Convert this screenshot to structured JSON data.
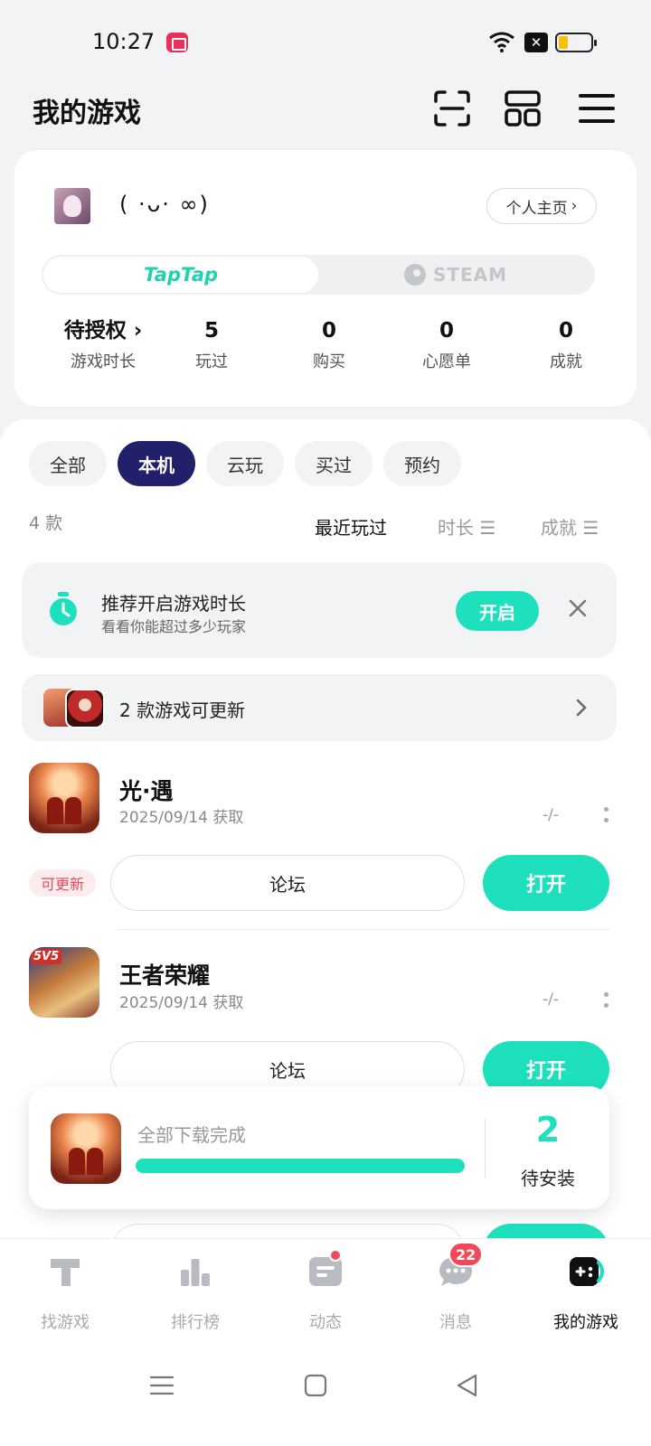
{
  "status_bar": {
    "time": "10:27"
  },
  "header": {
    "title": "我的游戏"
  },
  "profile": {
    "nickname": "( ·ᴗ· ∞)",
    "profile_button": "个人主页",
    "platforms": {
      "taptap": "TapTap",
      "steam": "STEAM"
    },
    "stats": [
      {
        "value": "待授权",
        "label": "游戏时长"
      },
      {
        "value": "5",
        "label": "玩过"
      },
      {
        "value": "0",
        "label": "购买"
      },
      {
        "value": "0",
        "label": "心愿单"
      },
      {
        "value": "0",
        "label": "成就"
      }
    ]
  },
  "filters": [
    "全部",
    "本机",
    "云玩",
    "买过",
    "预约"
  ],
  "active_filter": "本机",
  "list_count": "4 款",
  "sort": {
    "recent": "最近玩过",
    "duration": "时长",
    "achievement": "成就"
  },
  "banner": {
    "title": "推荐开启游戏时长",
    "subtitle": "看看你能超过多少玩家",
    "button": "开启"
  },
  "update_notice": "2 款游戏可更新",
  "games": [
    {
      "name": "光·遇",
      "date": "2025/09/14 获取",
      "playtime": "-/-",
      "tag": "可更新",
      "forum": "论坛",
      "open": "打开"
    },
    {
      "name": "王者荣耀",
      "date": "2025/09/14 获取",
      "playtime": "-/-",
      "tag": "",
      "forum": "论坛",
      "open": "打开",
      "badge": "5V5"
    }
  ],
  "download": {
    "status": "全部下载完成",
    "progress": 1.0,
    "count": "2",
    "label": "待安装"
  },
  "tabs": [
    {
      "label": "找游戏",
      "icon": "taptap-logo-icon"
    },
    {
      "label": "排行榜",
      "icon": "ranking-icon"
    },
    {
      "label": "动态",
      "icon": "feed-icon"
    },
    {
      "label": "消息",
      "icon": "message-icon",
      "badge": "22"
    },
    {
      "label": "我的游戏",
      "icon": "my-games-icon",
      "active": true
    }
  ],
  "colors": {
    "accent": "#1fe0bd",
    "filter_active": "#23206b",
    "badge": "#f04a5a"
  }
}
